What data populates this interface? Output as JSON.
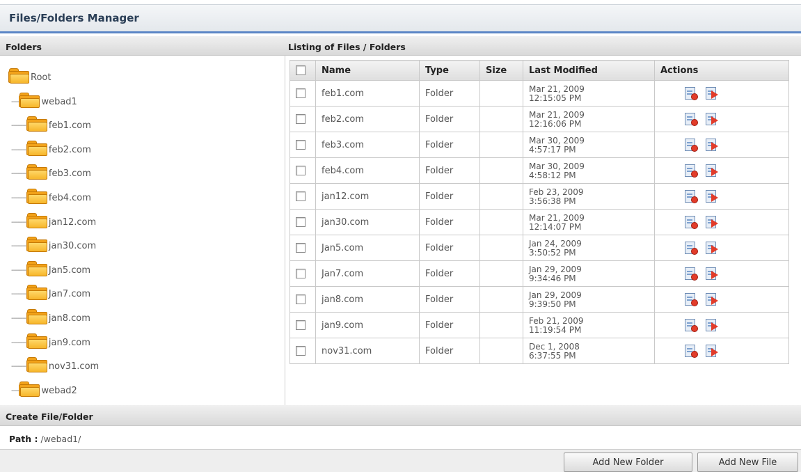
{
  "app": {
    "title": "Files/Folders Manager"
  },
  "folders_panel": {
    "title": "Folders",
    "tree": [
      {
        "label": "Root",
        "dashes": "",
        "indent": 0
      },
      {
        "label": "webad1",
        "dashes": "----",
        "indent": 1
      },
      {
        "label": "feb1.com",
        "dashes": "--------",
        "indent": 2
      },
      {
        "label": "feb2.com",
        "dashes": "--------",
        "indent": 2
      },
      {
        "label": "feb3.com",
        "dashes": "--------",
        "indent": 2
      },
      {
        "label": "feb4.com",
        "dashes": "--------",
        "indent": 2
      },
      {
        "label": "jan12.com",
        "dashes": "--------",
        "indent": 2
      },
      {
        "label": "jan30.com",
        "dashes": "--------",
        "indent": 2
      },
      {
        "label": "Jan5.com",
        "dashes": "--------",
        "indent": 2
      },
      {
        "label": "Jan7.com",
        "dashes": "--------",
        "indent": 2
      },
      {
        "label": "jan8.com",
        "dashes": "--------",
        "indent": 2
      },
      {
        "label": "jan9.com",
        "dashes": "--------",
        "indent": 2
      },
      {
        "label": "nov31.com",
        "dashes": "--------",
        "indent": 2
      },
      {
        "label": "webad2",
        "dashes": "----",
        "indent": 1
      }
    ]
  },
  "listing": {
    "title": "Listing of Files / Folders",
    "columns": [
      "Name",
      "Type",
      "Size",
      "Last Modified",
      "Actions"
    ],
    "rows": [
      {
        "name": "feb1.com",
        "type": "Folder",
        "size": "",
        "modified_date": "Mar 21, 2009",
        "modified_time": "12:15:05 PM"
      },
      {
        "name": "feb2.com",
        "type": "Folder",
        "size": "",
        "modified_date": "Mar 21, 2009",
        "modified_time": "12:16:06 PM"
      },
      {
        "name": "feb3.com",
        "type": "Folder",
        "size": "",
        "modified_date": "Mar 30, 2009",
        "modified_time": "4:57:17 PM"
      },
      {
        "name": "feb4.com",
        "type": "Folder",
        "size": "",
        "modified_date": "Mar 30, 2009",
        "modified_time": "4:58:12 PM"
      },
      {
        "name": "jan12.com",
        "type": "Folder",
        "size": "",
        "modified_date": "Feb 23, 2009",
        "modified_time": "3:56:38 PM"
      },
      {
        "name": "jan30.com",
        "type": "Folder",
        "size": "",
        "modified_date": "Mar 21, 2009",
        "modified_time": "12:14:07 PM"
      },
      {
        "name": "Jan5.com",
        "type": "Folder",
        "size": "",
        "modified_date": "Jan 24, 2009",
        "modified_time": "3:50:52 PM"
      },
      {
        "name": "Jan7.com",
        "type": "Folder",
        "size": "",
        "modified_date": "Jan 29, 2009",
        "modified_time": "9:34:46 PM"
      },
      {
        "name": "jan8.com",
        "type": "Folder",
        "size": "",
        "modified_date": "Jan 29, 2009",
        "modified_time": "9:39:50 PM"
      },
      {
        "name": "jan9.com",
        "type": "Folder",
        "size": "",
        "modified_date": "Feb 21, 2009",
        "modified_time": "11:19:54 PM"
      },
      {
        "name": "nov31.com",
        "type": "Folder",
        "size": "",
        "modified_date": "Dec 1, 2008",
        "modified_time": "6:37:55 PM"
      }
    ],
    "action_icons": [
      "delete-icon",
      "rename-icon"
    ]
  },
  "create": {
    "title": "Create File/Folder",
    "path_label": "Path :",
    "path_value": "/webad1/",
    "add_folder_label": "Add New Folder",
    "add_file_label": "Add New File"
  }
}
